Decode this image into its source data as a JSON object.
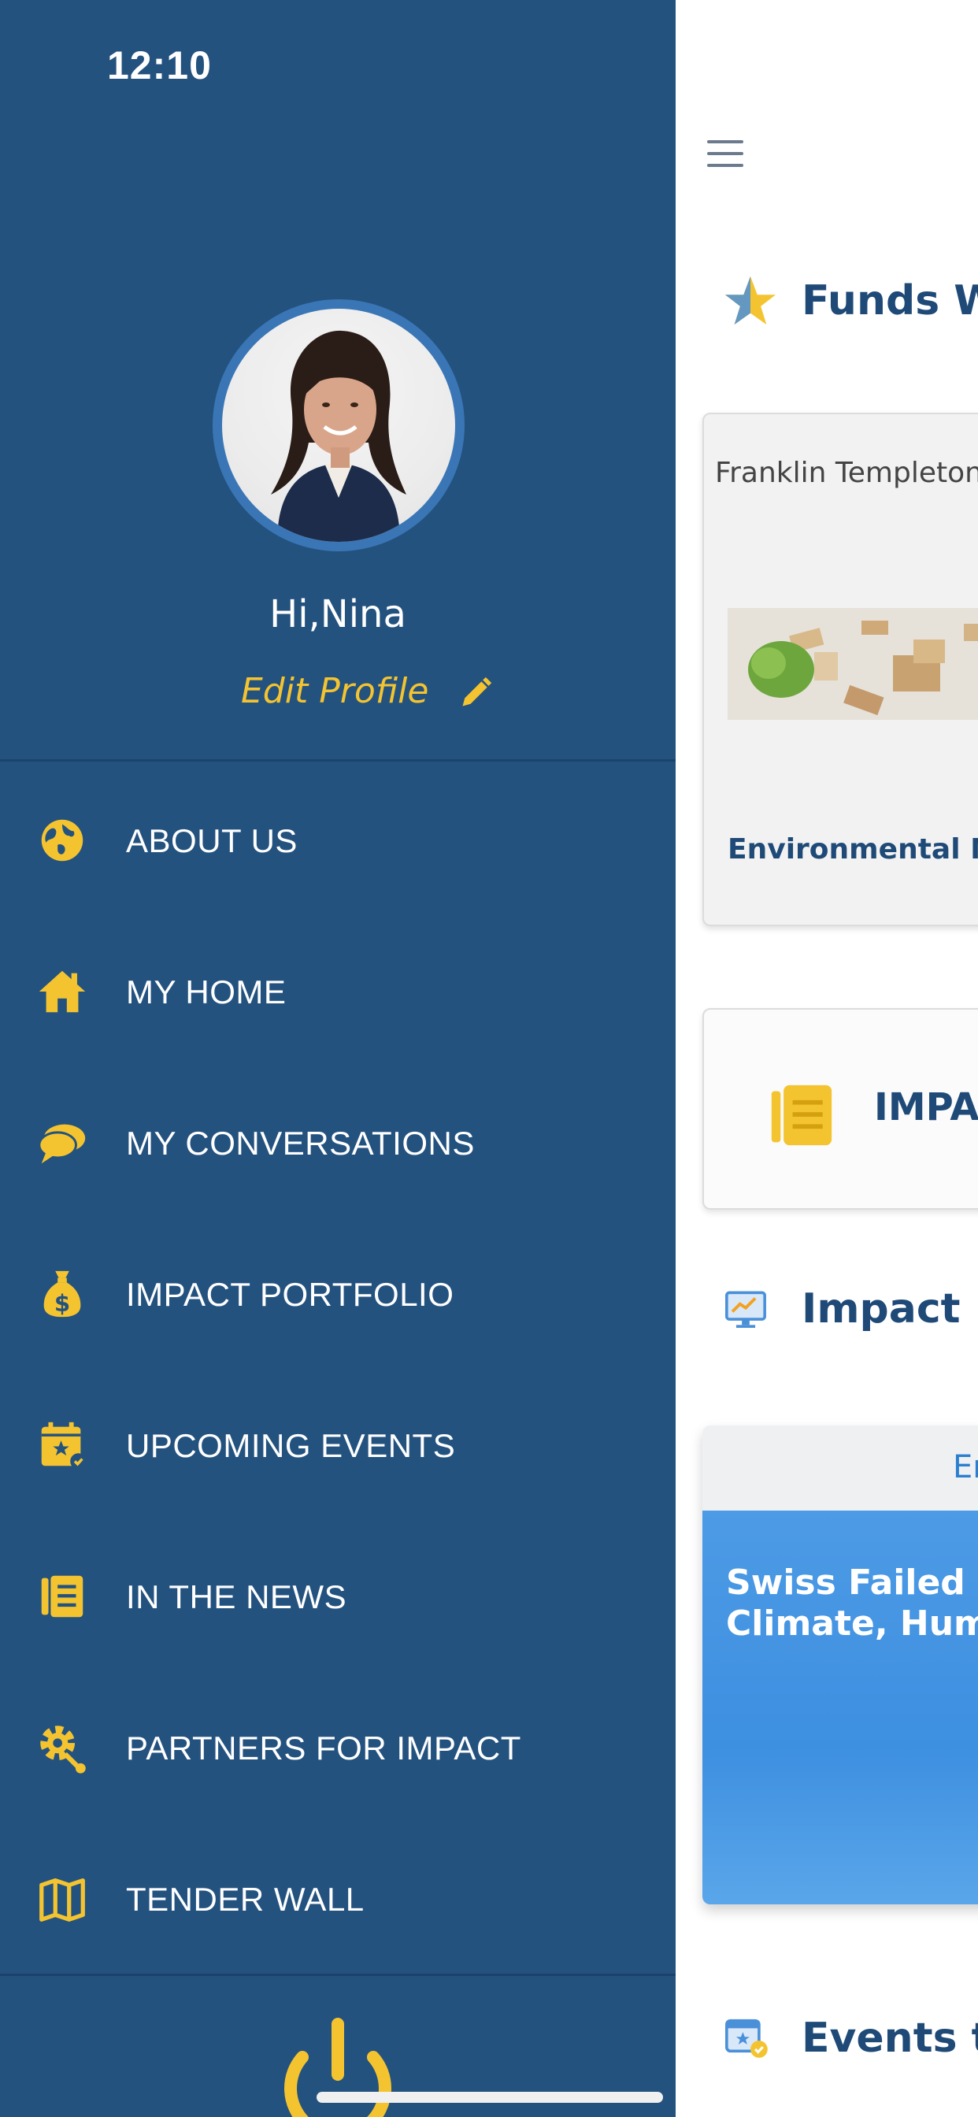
{
  "status_bar": {
    "time": "12:10"
  },
  "profile": {
    "greeting": "Hi,Nina",
    "edit_label": "Edit Profile"
  },
  "menu": [
    {
      "label": "ABOUT US",
      "icon": "globe-icon"
    },
    {
      "label": "MY HOME",
      "icon": "home-icon"
    },
    {
      "label": "MY CONVERSATIONS",
      "icon": "chat-icon"
    },
    {
      "label": "IMPACT PORTFOLIO",
      "icon": "money-bag-icon"
    },
    {
      "label": "UPCOMING EVENTS",
      "icon": "calendar-icon"
    },
    {
      "label": "IN THE NEWS",
      "icon": "news-icon"
    },
    {
      "label": "PARTNERS FOR IMPACT",
      "icon": "gear-wrench-icon"
    },
    {
      "label": "TENDER WALL",
      "icon": "map-icon"
    }
  ],
  "content": {
    "funds_title": "Funds Wa",
    "fund_card": {
      "provider": "Franklin Templeton",
      "name": "Environmental Ma"
    },
    "impact_card": {
      "label": "IMPAC"
    },
    "impact_news_title": "Impact N",
    "news_card": {
      "tab": "En",
      "headline": "Swiss Failed Cit\nClimate, Human"
    },
    "events_title": "Events to"
  },
  "colors": {
    "drawer": "#24527f",
    "accent": "#f4c430",
    "title": "#1f4a78"
  }
}
